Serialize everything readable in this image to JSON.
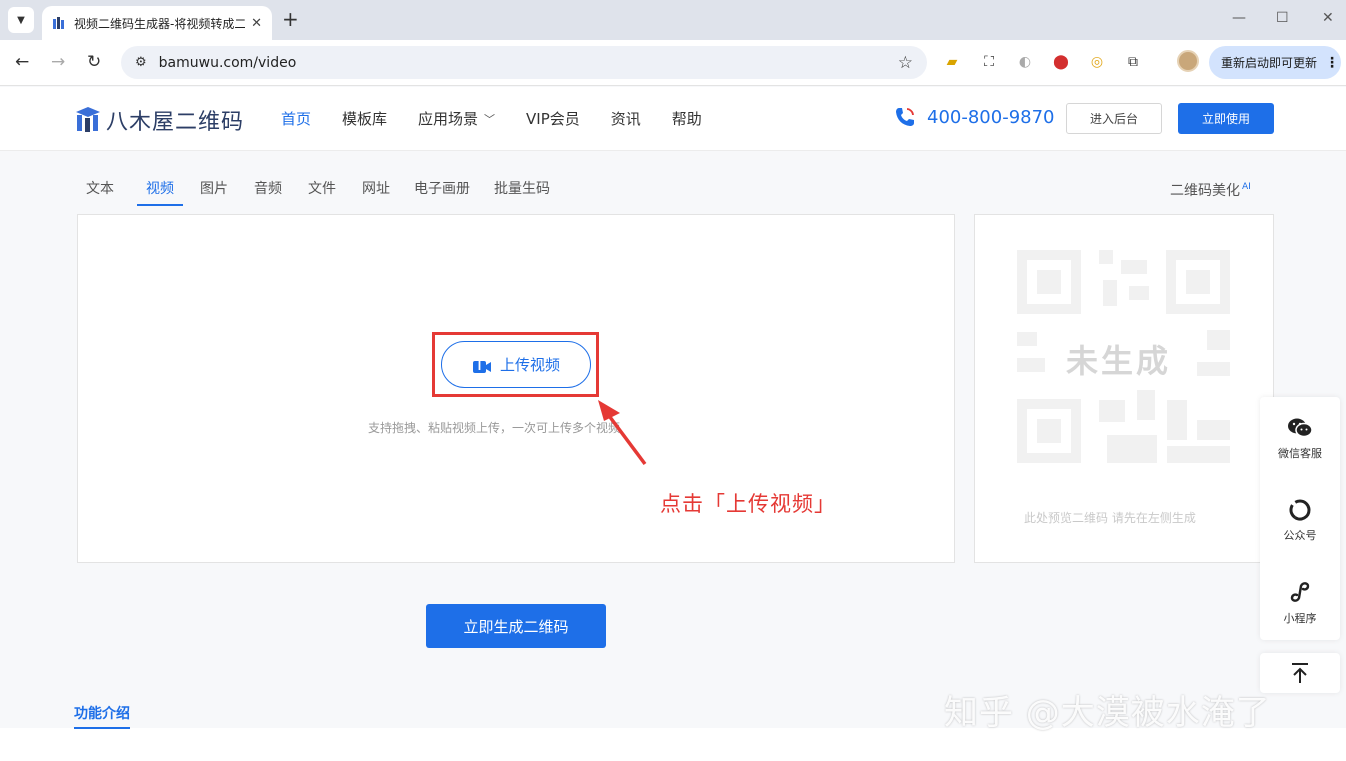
{
  "browser": {
    "tab_title": "视频二维码生成器-将视频转成二维码",
    "url": "bamuwu.com/video",
    "update_label": "重新启动即可更新"
  },
  "header": {
    "logo_text": "八木屋二维码",
    "nav": [
      "首页",
      "模板库",
      "应用场景",
      "VIP会员",
      "资讯",
      "帮助"
    ],
    "phone": "400-800-9870",
    "backend_label": "进入后台",
    "use_label": "立即使用"
  },
  "subtabs": [
    "文本",
    "视频",
    "图片",
    "音频",
    "文件",
    "网址",
    "电子画册",
    "批量生码"
  ],
  "beautify": {
    "label": "二维码美化",
    "badge": "AI"
  },
  "upload": {
    "button_label": "上传视频",
    "hint": "支持拖拽、粘贴视频上传，一次可上传多个视频"
  },
  "annotation": "点击「上传视频」",
  "preview": {
    "placeholder_label": "未生成",
    "hint": "此处预览二维码 请先在左侧生成"
  },
  "generate_label": "立即生成二维码",
  "feature_intro": "功能介绍",
  "side": {
    "wechat_service": "微信客服",
    "official_account": "公众号",
    "mini_program": "小程序"
  },
  "watermark": "知乎 @大漠被水淹了",
  "colors": {
    "brand": "#1e6fe8",
    "annotation_red": "#e53935"
  }
}
